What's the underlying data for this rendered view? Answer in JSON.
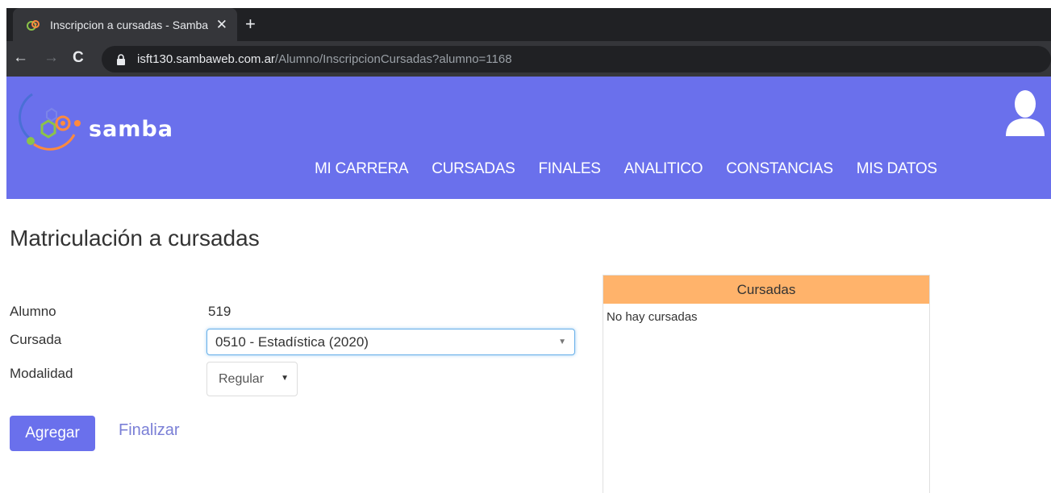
{
  "browser": {
    "tab_title": "Inscripcion a cursadas - Samba",
    "tab_close": "✕",
    "new_tab": "+",
    "url_host": "isft130.sambaweb.com.ar",
    "url_path": "/Alumno/InscripcionCursadas?alumno=1168"
  },
  "header": {
    "logo_text": "samba",
    "brand_color": "#6a70ec",
    "nav": [
      "MI CARRERA",
      "CURSADAS",
      "FINALES",
      "ANALITICO",
      "CONSTANCIAS",
      "MIS DATOS"
    ]
  },
  "page": {
    "title": "Matriculación a cursadas"
  },
  "form": {
    "alumno_label": "Alumno",
    "alumno_value": "519",
    "cursada_label": "Cursada",
    "cursada_value": "0510 - Estadística (2020)",
    "modalidad_label": "Modalidad",
    "modalidad_value": "Regular",
    "agregar_label": "Agregar",
    "finalizar_label": "Finalizar"
  },
  "panel": {
    "title": "Cursadas",
    "empty_text": "No hay cursadas",
    "header_color": "#ffb36b"
  }
}
